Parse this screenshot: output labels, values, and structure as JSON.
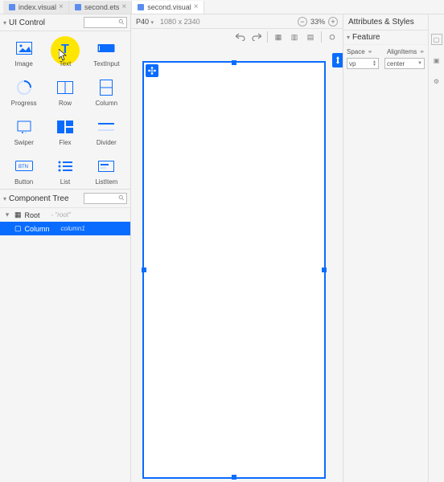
{
  "tabs": [
    {
      "label": "index.visual",
      "iconColor": "#5b8def",
      "active": false
    },
    {
      "label": "second.ets",
      "iconColor": "#5b8def",
      "active": false
    },
    {
      "label": "second.visual",
      "iconColor": "#5b8def",
      "active": true
    }
  ],
  "uiControl": {
    "title": "UI Control",
    "searchPlaceholder": ""
  },
  "palette": [
    {
      "name": "Image",
      "icon": "image"
    },
    {
      "name": "Text",
      "icon": "text",
      "highlighted": true
    },
    {
      "name": "TextInput",
      "icon": "textinput"
    },
    {
      "name": "Progress",
      "icon": "progress"
    },
    {
      "name": "Row",
      "icon": "row"
    },
    {
      "name": "Column",
      "icon": "column"
    },
    {
      "name": "Swiper",
      "icon": "swiper"
    },
    {
      "name": "Flex",
      "icon": "flex"
    },
    {
      "name": "Divider",
      "icon": "divider"
    },
    {
      "name": "Button",
      "icon": "button"
    },
    {
      "name": "List",
      "icon": "list"
    },
    {
      "name": "ListItem",
      "icon": "listitem"
    }
  ],
  "componentTree": {
    "title": "Component Tree",
    "root": {
      "label": "Root",
      "hint": "- \"root\""
    },
    "selected": {
      "label": "Column",
      "hint": "column1"
    }
  },
  "topbar": {
    "device": "P40",
    "dimensions": "1080 x 2340",
    "zoom": "33%"
  },
  "attrs": {
    "title": "Attributes & Styles",
    "feature": "Feature",
    "space": {
      "label": "Space",
      "unit": "vp"
    },
    "alignItems": {
      "label": "AlignItems",
      "value": "center"
    }
  }
}
